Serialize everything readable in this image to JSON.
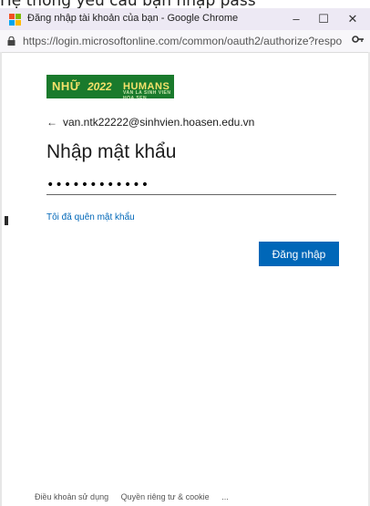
{
  "background_caption": "Hệ thống yêu cầu bạn nhập pass",
  "window": {
    "title": "Đăng nhập tài khoản của bạn - Google Chrome",
    "minimize_label": "–",
    "maximize_label": "☐",
    "close_label": "✕"
  },
  "address_bar": {
    "url": "https://login.microsoftonline.com/common/oauth2/authorize?respo",
    "key_icon": "key-icon"
  },
  "logo": {
    "primary": "NHỮ",
    "year": "2022",
    "humans": "HUMANS",
    "subtitle": "VAN LA SINH VIEN HOA SEN"
  },
  "login": {
    "account": "van.ntk22222@sinhvien.hoasen.edu.vn",
    "back_icon": "←",
    "heading": "Nhập mật khẩu",
    "password_mask": "••••••••••••",
    "forgot_link": "Tôi đã quên mật khẩu",
    "submit_label": "Đăng nhập"
  },
  "footer": {
    "terms": "Điều khoản sử dụng",
    "privacy": "Quyền riêng tư & cookie",
    "more": "..."
  },
  "colors": {
    "accent": "#0067b8",
    "titlebar": "#ede9f4",
    "logo_bg": "#1a7a2c"
  }
}
